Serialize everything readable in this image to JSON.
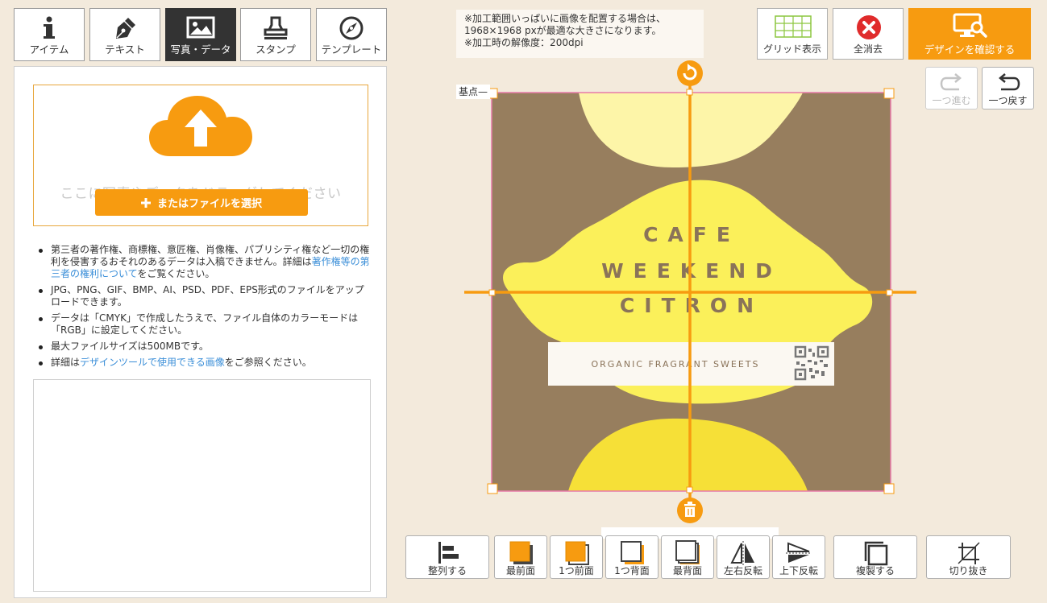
{
  "tabs": [
    {
      "label": "アイテム",
      "icon": "info-icon"
    },
    {
      "label": "テキスト",
      "icon": "pen-nib-icon"
    },
    {
      "label": "写真・データ",
      "icon": "image-icon"
    },
    {
      "label": "スタンプ",
      "icon": "stamp-icon"
    },
    {
      "label": "テンプレート",
      "icon": "compass-icon"
    }
  ],
  "active_tab": "写真・データ",
  "upload": {
    "drop_text": "ここに写真やデータをドラッグしてください",
    "file_button": "またはファイルを選択"
  },
  "notes": {
    "n1_pre": "第三者の著作権、商標権、意匠権、肖像権、パブリシティ権など一切の権利を侵害するおそれのあるデータは入稿できません。詳細は",
    "n1_link": "著作権等の第三者の権利について",
    "n1_post": "をご覧ください。",
    "n2": "JPG、PNG、GIF、BMP、AI、PSD、PDF、EPS形式のファイルをアップロードできます。",
    "n3": "データは「CMYK」で作成したうえで、ファイル自体のカラーモードは「RGB」に設定してください。",
    "n4": "最大ファイルサイズは500MBです。",
    "n5_pre": "詳細は",
    "n5_link": "デザインツールで使用できる画像",
    "n5_post": "をご参照ください。"
  },
  "notice": {
    "line1": "※加工範囲いっぱいに画像を配置する場合は、",
    "line2": "1968×1968 pxが最適な大きさになります。",
    "line3": "※加工時の解像度：200dpi"
  },
  "toolbar": {
    "grid": "グリッド表示",
    "clear_all": "全消去",
    "confirm": "デザインを確認する",
    "redo": "一つ進む",
    "undo": "一つ戻す"
  },
  "canvas": {
    "base_label": "基点",
    "design_line1": "CAFE",
    "design_line2": "WEEKEND",
    "design_line3": "CITRON",
    "design_tagline": "ORGANIC FRAGRANT SWEETS"
  },
  "bottom": {
    "align": "整列する",
    "front_most": "最前面",
    "front_one": "1つ前面",
    "back_one": "1つ背面",
    "back_most": "最背面",
    "flip_h": "左右反転",
    "flip_v": "上下反転",
    "duplicate": "複製する",
    "crop": "切り抜き"
  },
  "colors": {
    "accent": "#f79b10",
    "design_bg": "#977e5e",
    "lemon": "#fbf05a",
    "lemon_light": "#fdf5a8",
    "selection_border": "#e87aa8"
  }
}
